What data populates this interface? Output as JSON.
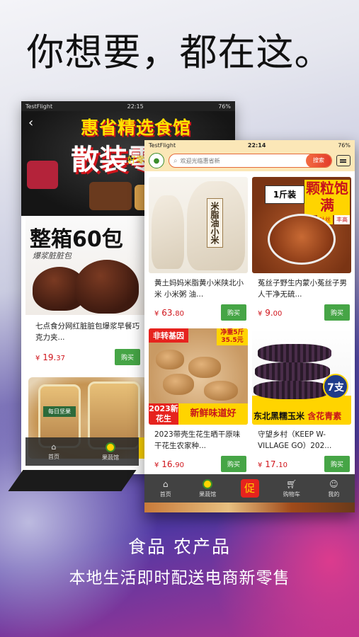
{
  "headline": "你想要，都在这。",
  "back_phone": {
    "status_left": "TestFlight",
    "status_time": "22:15",
    "status_battery": "76%",
    "banner_store": "惠省精选食馆",
    "banner_promo": "散装零食",
    "banner_promo_sub": "好零食 放心吃",
    "product1": {
      "tag": "整箱60包",
      "tag_sub": "爆浆脏脏包",
      "title": "七点食分网红脏脏包爆浆早餐巧克力夹...",
      "price_symbol": "¥",
      "price_int": "19.",
      "price_dec": "37",
      "buy_label": "购买"
    },
    "product2_badge": "每日坚果",
    "nav": [
      {
        "label": "首页",
        "icon": "home-icon"
      },
      {
        "label": "果蔬馆",
        "icon": "shop-icon"
      }
    ],
    "side_button": "促"
  },
  "front_phone": {
    "status_left": "TestFlight",
    "status_time": "22:14",
    "status_battery": "76%",
    "search_placeholder": "欢迎光临惠省新",
    "search_button": "搜索",
    "products": [
      {
        "title": "黄土妈妈米脂黄小米陕北小米 小米粥 油...",
        "price_int": "63.",
        "price_dec": "80",
        "art_label": "米脂油小米",
        "buy_label": "购买"
      },
      {
        "title": "菟丝子野生内蒙小菟丝子男人干净无硫...",
        "price_int": "9.",
        "price_dec": "00",
        "weight_label": "1斤装",
        "badge": "颗粒饱满",
        "tags": [
          "吐丝",
          "丰高"
        ],
        "buy_label": "购买"
      },
      {
        "title": "2023带壳生花生晒干原味干花生农家种...",
        "price_int": "16.",
        "price_dec": "90",
        "tag_left": "非转基因",
        "tag_right": "净重5斤 35.5元",
        "year_label": "2023新花生",
        "fresh_label": "新鲜味道好",
        "buy_label": "购买"
      },
      {
        "title": "守望乡村（KEEP W-VILLAGE GO）202...",
        "price_int": "17.",
        "price_dec": "10",
        "badge": "7支",
        "art_text": "东北黑糯玉米",
        "art_text_red": "含花青素",
        "buy_label": "购买"
      }
    ],
    "price_symbol": "¥",
    "nav": [
      {
        "label": "首页",
        "icon": "home-icon"
      },
      {
        "label": "果蔬馆",
        "icon": "shop-icon"
      },
      {
        "label": "",
        "icon": "promo-icon",
        "glyph": "促"
      },
      {
        "label": "购物车",
        "icon": "cart-icon"
      },
      {
        "label": "我的",
        "icon": "user-icon"
      }
    ]
  },
  "caption_line1": "食品  农产品",
  "caption_line2": "本地生活即时配送电商新零售",
  "colors": {
    "accent_red": "#e6231e",
    "buy_green": "#46a546",
    "header_cream": "#fbe7b7",
    "promo_yellow": "#ffd400"
  }
}
